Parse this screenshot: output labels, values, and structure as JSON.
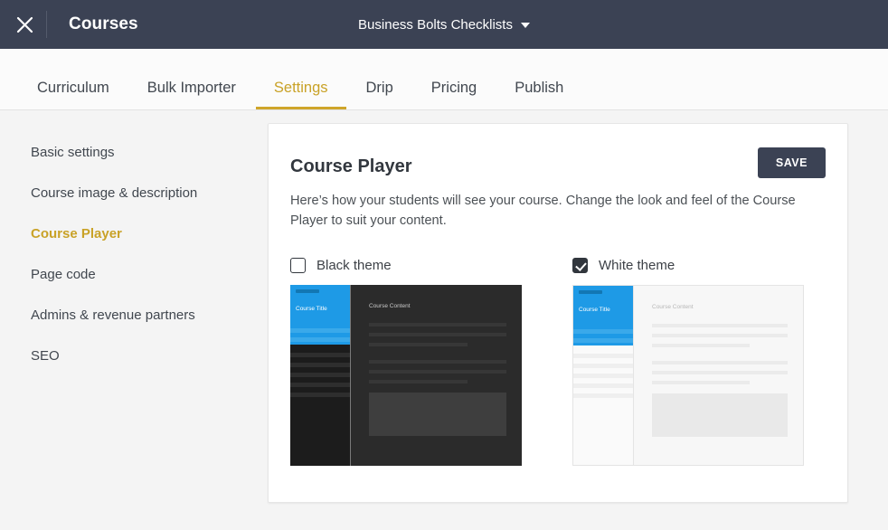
{
  "topbar": {
    "close_icon": "close-icon",
    "section_label": "Courses",
    "course_name": "Business Bolts Checklists",
    "caret_icon": "chevron-down-icon"
  },
  "tabs": [
    {
      "label": "Curriculum",
      "active": false
    },
    {
      "label": "Bulk Importer",
      "active": false
    },
    {
      "label": "Settings",
      "active": true
    },
    {
      "label": "Drip",
      "active": false
    },
    {
      "label": "Pricing",
      "active": false
    },
    {
      "label": "Publish",
      "active": false
    }
  ],
  "sidenav": {
    "items": [
      {
        "label": "Basic settings",
        "active": false
      },
      {
        "label": "Course image & description",
        "active": false
      },
      {
        "label": "Course Player",
        "active": true
      },
      {
        "label": "Page code",
        "active": false
      },
      {
        "label": "Admins & revenue partners",
        "active": false
      },
      {
        "label": "SEO",
        "active": false
      }
    ]
  },
  "card": {
    "title": "Course Player",
    "save_label": "SAVE",
    "description": "Here’s how your students will see your course. Change the look and feel of the Course Player to suit your content."
  },
  "themes": [
    {
      "label": "Black theme",
      "checked": false,
      "preview": {
        "hero_title": "Course Title",
        "content_title": "Course Content"
      }
    },
    {
      "label": "White theme",
      "checked": true,
      "preview": {
        "hero_title": "Course Title",
        "content_title": "Course Content"
      }
    }
  ],
  "colors": {
    "topbar_bg": "#3b4254",
    "accent_gold": "#c9a227",
    "preview_blue": "#1e9ae6",
    "save_bg": "#3b4254",
    "page_bg": "#f4f4f4"
  }
}
